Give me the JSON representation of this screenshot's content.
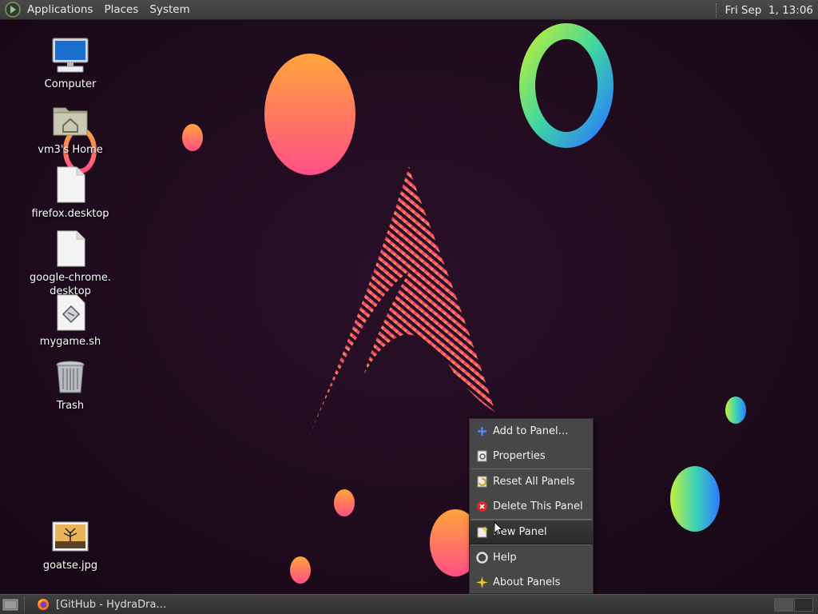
{
  "top_panel": {
    "menus": [
      "Applications",
      "Places",
      "System"
    ],
    "clock": "Fri Sep  1, 13:06"
  },
  "bottom_panel": {
    "task_label": "[GitHub - HydraDra…",
    "workspaces": 2
  },
  "desktop_icons": [
    {
      "label": "Computer",
      "icon": "computer-icon"
    },
    {
      "label": "vm3's Home",
      "icon": "home-folder-icon"
    },
    {
      "label": "firefox.desktop",
      "icon": "file-icon"
    },
    {
      "label": "google-chrome.\ndesktop",
      "icon": "file-icon"
    },
    {
      "label": "mygame.sh",
      "icon": "script-icon"
    },
    {
      "label": "Trash",
      "icon": "trash-icon"
    },
    {
      "label": "goatse.jpg",
      "icon": "image-icon"
    }
  ],
  "context_menu": {
    "items": [
      {
        "label": "Add to Panel…",
        "icon": "plus-icon"
      },
      {
        "label": "Properties",
        "icon": "properties-icon"
      },
      {
        "label": "Reset All Panels",
        "icon": "reset-icon"
      },
      {
        "label": "Delete This Panel",
        "icon": "delete-icon"
      },
      {
        "label": "New Panel",
        "icon": "new-panel-icon"
      },
      {
        "label": "Help",
        "icon": "help-icon"
      },
      {
        "label": "About Panels",
        "icon": "about-icon"
      }
    ]
  },
  "colors": {
    "panel": "#3a3a3a",
    "menu_bg": "#474747",
    "wallpaper_bg": "#1e0b1d",
    "accent_pink": "#e8307a",
    "accent_orange": "#ff8a3d"
  }
}
